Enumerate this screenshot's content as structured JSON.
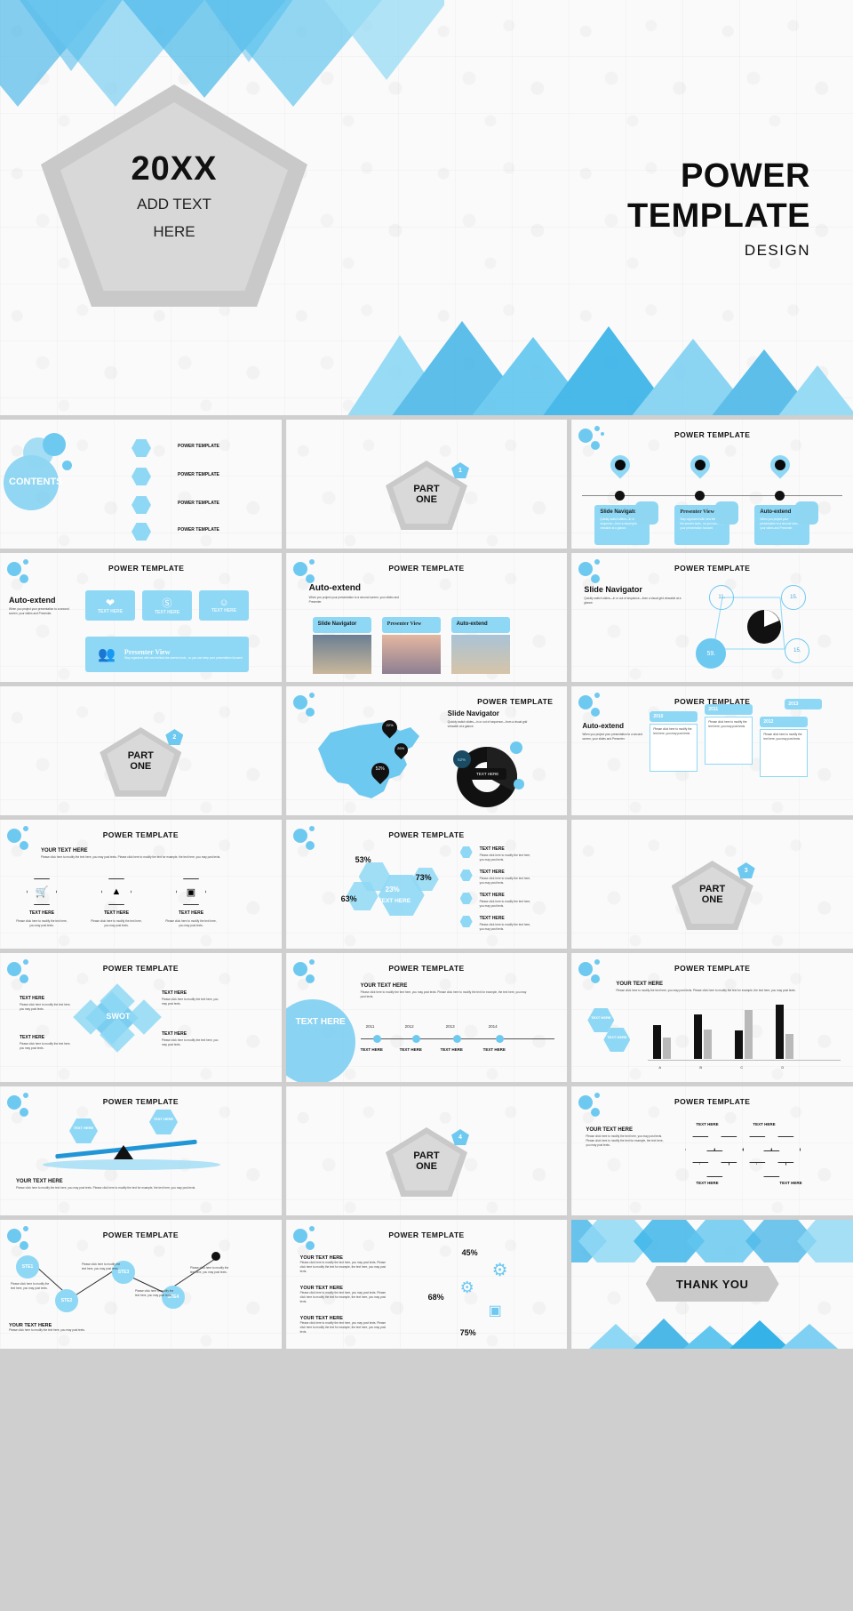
{
  "hero": {
    "year": "20XX",
    "sub_line1": "ADD TEXT",
    "sub_line2": "HERE",
    "title_line1": "POWER",
    "title_line2": "TEMPLATE",
    "design": "DESIGN"
  },
  "common": {
    "power_template": "POWER TEMPLATE",
    "text_here": "TEXT HERE",
    "your_text_here": "YOUR TEXT HERE",
    "lorem": "Please click here to modify the text here, you may post texts. Please click here to modify the text for example, the text here, you may post texts.",
    "lorem_short": "Please click here to modify the text here, you may post texts.",
    "auto_extend": "Auto-extend",
    "auto_extend_body": "When you project your presentation to a second screen, your slides and Presenter.",
    "slide_navigator": "Slide Navigator",
    "slide_navigator_body": "Quickly switch slides—in or out of sequence—from a visual grid viewable at a glance.",
    "presenter_view": "Presenter View",
    "presenter_view_body": "Stay organized with new behind-the-scenes tools , so you can keep your presentation focused",
    "part": "PART",
    "one": "ONE",
    "contents": "CONTENTS",
    "thank_you": "THANK YOU",
    "swot": "SWOT"
  },
  "slides": [
    {
      "n": 1,
      "name": "contents",
      "title": "",
      "items": [
        "POWER TEMPLATE",
        "POWER TEMPLATE",
        "POWER TEMPLATE",
        "POWER TEMPLATE"
      ]
    },
    {
      "n": 2,
      "name": "part-one-1",
      "num": "1"
    },
    {
      "n": 3,
      "name": "three-pin-cards",
      "cards": [
        "Slide Navigator",
        "Presenter View",
        "Auto-extend"
      ]
    },
    {
      "n": 4,
      "name": "speech-bubbles",
      "bubbles": [
        "TEXT HERE",
        "TEXT HERE",
        "TEXT HERE"
      ],
      "banner": "Presenter View"
    },
    {
      "n": 5,
      "name": "photo-cards",
      "cards": [
        "Slide Navigator",
        "Presenter View",
        "Auto-extend"
      ]
    },
    {
      "n": 6,
      "name": "donut-circles",
      "circles": [
        "11.",
        "15.",
        "59.",
        "15."
      ]
    },
    {
      "n": 7,
      "name": "part-one-2",
      "num": "2"
    },
    {
      "n": 8,
      "name": "map-stats",
      "pins": [
        "22%",
        "26%",
        "52%"
      ],
      "donut": "52%"
    },
    {
      "n": 9,
      "name": "timeline-cards",
      "years": [
        "2010",
        "2011",
        "2012",
        "2013"
      ]
    },
    {
      "n": 10,
      "name": "three-hex-icons",
      "labels": [
        "TEXT HERE",
        "TEXT HERE",
        "TEXT HERE"
      ],
      "icons": [
        "cart-icon",
        "pie-icon",
        "monitor-icon"
      ]
    },
    {
      "n": 11,
      "name": "hex-percent",
      "percents": [
        "53%",
        "63%",
        "23%",
        "73%"
      ],
      "list": [
        "TEXT HERE",
        "TEXT HERE",
        "TEXT HERE",
        "TEXT HERE"
      ]
    },
    {
      "n": 12,
      "name": "part-one-3",
      "num": "3"
    },
    {
      "n": 13,
      "name": "swot-diagram",
      "center": "SWOT",
      "labels": [
        "TEXT HERE",
        "TEXT HERE",
        "TEXT HERE",
        "TEXT HERE"
      ]
    },
    {
      "n": 14,
      "name": "year-timeline",
      "years": [
        "2011",
        "2012",
        "2013",
        "2014"
      ],
      "labels": [
        "TEXT HERE",
        "TEXT HERE",
        "TEXT HERE",
        "TEXT HERE"
      ],
      "big": "TEXT HERE"
    },
    {
      "n": 15,
      "name": "bar-chart"
    },
    {
      "n": 16,
      "name": "seesaw"
    },
    {
      "n": 17,
      "name": "part-one-4",
      "num": "4"
    },
    {
      "n": 18,
      "name": "hex-chain",
      "labels": [
        "TEXT HERE",
        "TEXT HERE",
        "TEXT HERE",
        "TEXT HERE"
      ]
    },
    {
      "n": 19,
      "name": "steps",
      "steps": [
        "STE1",
        "STE2",
        "STE3",
        "STE4"
      ]
    },
    {
      "n": 20,
      "name": "gear-percent",
      "percents": [
        "45%",
        "68%",
        "75%"
      ]
    },
    {
      "n": 21,
      "name": "thank-you",
      "text": "THANK YOU"
    }
  ],
  "chart_data": [
    {
      "type": "bar",
      "slide": "bar-chart",
      "categories": [
        "A",
        "B",
        "C",
        "D"
      ],
      "series": [
        {
          "name": "series-1",
          "values": [
            55,
            72,
            46,
            88
          ]
        },
        {
          "name": "series-2",
          "values": [
            34,
            48,
            80,
            40
          ]
        }
      ],
      "title": "POWER TEMPLATE",
      "xlabel": "",
      "ylabel": "",
      "ylim": [
        0,
        100
      ],
      "grid": false,
      "legend": "none"
    },
    {
      "type": "pie",
      "slide": "map-stats",
      "labels": [
        "52%",
        "26%",
        "22%"
      ],
      "values": [
        52,
        26,
        22
      ],
      "title": "Slide Navigator"
    },
    {
      "type": "bar",
      "slide": "hex-percent",
      "categories": [
        "53%",
        "63%",
        "23%",
        "73%"
      ],
      "values": [
        53,
        63,
        23,
        73
      ],
      "title": "POWER TEMPLATE"
    },
    {
      "type": "bar",
      "slide": "gear-percent",
      "categories": [
        "45%",
        "68%",
        "75%"
      ],
      "values": [
        45,
        68,
        75
      ],
      "title": "POWER TEMPLATE"
    },
    {
      "type": "bar",
      "slide": "donut-circles",
      "categories": [
        "11.",
        "15.",
        "59.",
        "15."
      ],
      "values": [
        11,
        15,
        59,
        15
      ],
      "title": "Slide Navigator"
    }
  ]
}
